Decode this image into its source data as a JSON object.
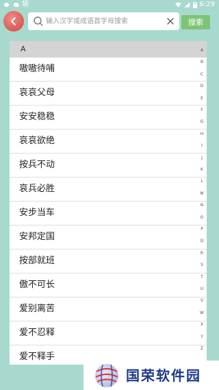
{
  "status_bar": {
    "left_icons": [
      "wechat-icon",
      "chat-icon",
      "pin-icon"
    ],
    "carrier_text": "袋",
    "time": "6:29",
    "right_icons": [
      "wifi-icon",
      "signal-icon",
      "battery-icon"
    ]
  },
  "header": {
    "search_placeholder": "输入汉字或成语首字母搜索",
    "search_value": "",
    "search_button_label": "搜索"
  },
  "list": {
    "section_label": "A",
    "items": [
      "嗷嗷待哺",
      "哀哀父母",
      "安安稳稳",
      "哀哀欲绝",
      "按兵不动",
      "哀兵必胜",
      "安步当车",
      "安邦定国",
      "按部就班",
      "傲不可长",
      "爱别离苦",
      "爱不忍释",
      "爱不释手"
    ]
  },
  "alphabet_index": [
    "A",
    "B",
    "C",
    "D",
    "E",
    "F",
    "G",
    "H",
    "I",
    "J",
    "K",
    "L",
    "M",
    "N",
    "O",
    "P",
    "Q",
    "R",
    "S",
    "T",
    "U",
    "V",
    "W",
    "X",
    "Y",
    "Z"
  ],
  "watermark": {
    "text": "国荣软件园"
  },
  "colors": {
    "background": "#a8d9cf",
    "search_button": "#7cc576",
    "back_button": "#e0605c",
    "section_header": "#d4d4d4",
    "watermark_text": "#1c3a8c"
  }
}
